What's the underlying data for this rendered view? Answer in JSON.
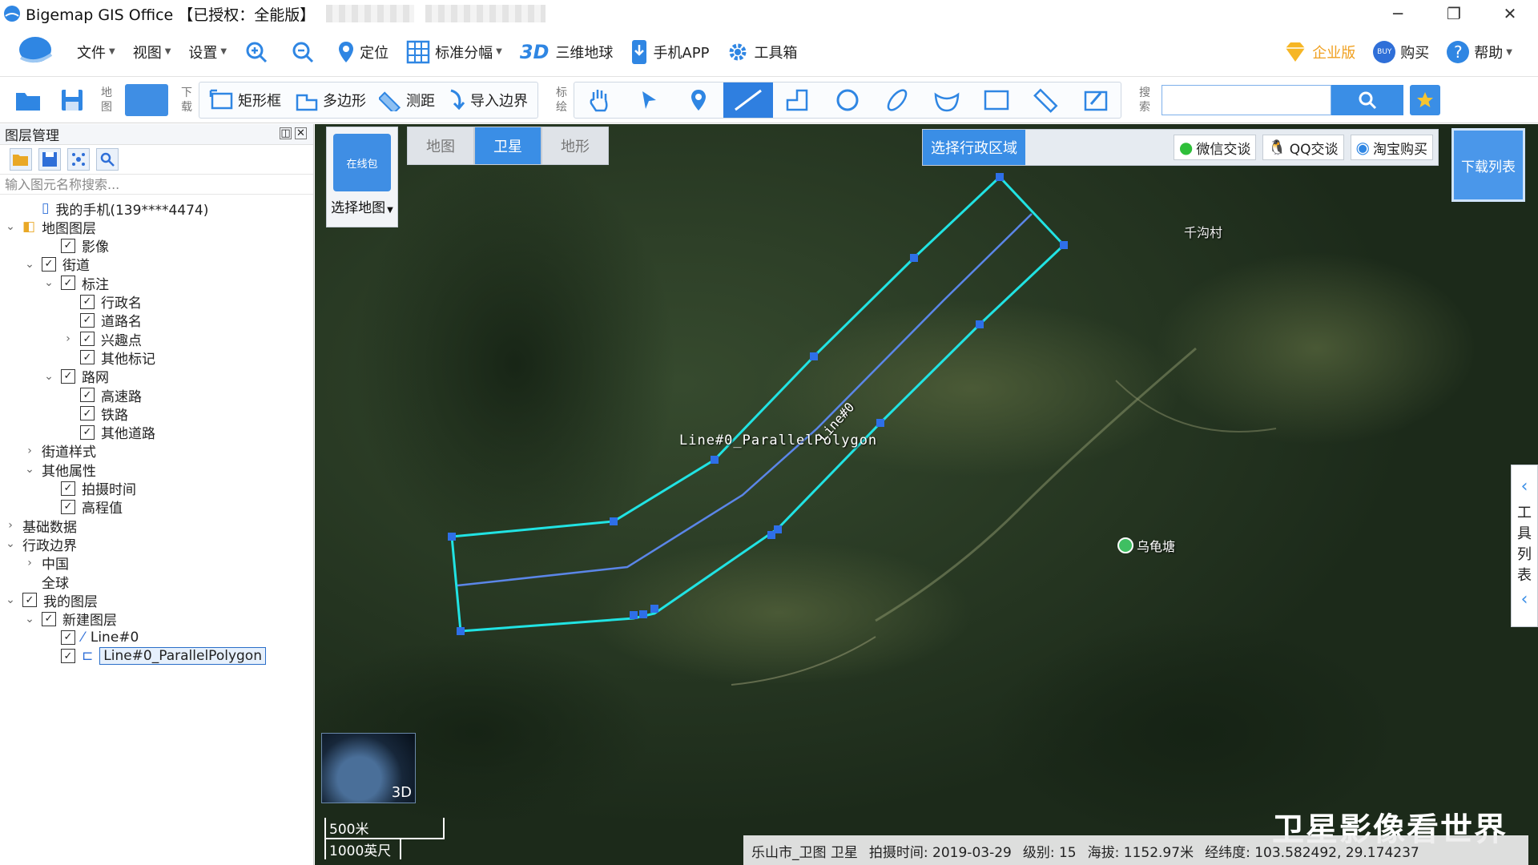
{
  "window": {
    "title": "Bigemap GIS Office 【已授权：全能版】",
    "minimize": "─",
    "restore": "❐",
    "close": "✕"
  },
  "menubar": {
    "items": [
      {
        "label": "文件"
      },
      {
        "label": "视图"
      },
      {
        "label": "设置"
      }
    ],
    "locate": "定位",
    "grid": "标准分幅",
    "three_d_mark": "3D",
    "earth": "三维地球",
    "mobile": "手机APP",
    "toolbox": "工具箱",
    "enterprise": "企业版",
    "buy": "购买",
    "buy_badge": "BUY",
    "help": "帮助"
  },
  "toolbar": {
    "map_label": "地图",
    "download_label": "下载",
    "rect": "矩形框",
    "polygon": "多边形",
    "measure": "测距",
    "import_boundary": "导入边界",
    "annotate_label": "标绘",
    "search_label": "搜索",
    "search_placeholder": ""
  },
  "layer_panel": {
    "title": "图层管理",
    "search_placeholder": "输入图元名称搜索...",
    "tree": [
      {
        "label": "我的手机(139****4474)",
        "level": 1,
        "arrow": "",
        "check": "none",
        "icon": "phone"
      },
      {
        "label": "地图图层",
        "level": 0,
        "arrow": "v",
        "check": "none",
        "icon": "layers"
      },
      {
        "label": "影像",
        "level": 2,
        "arrow": "",
        "check": "checked"
      },
      {
        "label": "街道",
        "level": 1,
        "arrow": "v",
        "check": "checked"
      },
      {
        "label": "标注",
        "level": 2,
        "arrow": "v",
        "check": "checked"
      },
      {
        "label": "行政名",
        "level": 3,
        "arrow": "",
        "check": "checked"
      },
      {
        "label": "道路名",
        "level": 3,
        "arrow": "",
        "check": "checked"
      },
      {
        "label": "兴趣点",
        "level": 3,
        "arrow": ">",
        "check": "checked"
      },
      {
        "label": "其他标记",
        "level": 3,
        "arrow": "",
        "check": "checked"
      },
      {
        "label": "路网",
        "level": 2,
        "arrow": "v",
        "check": "checked"
      },
      {
        "label": "高速路",
        "level": 3,
        "arrow": "",
        "check": "checked"
      },
      {
        "label": "铁路",
        "level": 3,
        "arrow": "",
        "check": "checked"
      },
      {
        "label": "其他道路",
        "level": 3,
        "arrow": "",
        "check": "checked"
      },
      {
        "label": "街道样式",
        "level": 1,
        "arrow": ">",
        "check": "none"
      },
      {
        "label": "其他属性",
        "level": 1,
        "arrow": "v",
        "check": "none"
      },
      {
        "label": "拍摄时间",
        "level": 2,
        "arrow": "",
        "check": "checked"
      },
      {
        "label": "高程值",
        "level": 2,
        "arrow": "",
        "check": "checked"
      },
      {
        "label": "基础数据",
        "level": 0,
        "arrow": ">",
        "check": "none"
      },
      {
        "label": "行政边界",
        "level": 0,
        "arrow": "v",
        "check": "none"
      },
      {
        "label": "中国",
        "level": 1,
        "arrow": ">",
        "check": "none"
      },
      {
        "label": "全球",
        "level": 1,
        "arrow": "",
        "check": "none"
      },
      {
        "label": "我的图层",
        "level": 0,
        "arrow": "v",
        "check": "checked"
      },
      {
        "label": "新建图层",
        "level": 1,
        "arrow": "v",
        "check": "checked"
      },
      {
        "label": "Line#0",
        "level": 2,
        "arrow": "",
        "check": "checked",
        "icon": "line"
      },
      {
        "label": "Line#0_ParallelPolygon",
        "level": 2,
        "arrow": "",
        "check": "checked",
        "icon": "polygon",
        "selected": true
      }
    ]
  },
  "map": {
    "type_tabs": [
      {
        "label": "地图",
        "active": false
      },
      {
        "label": "卫星",
        "active": true
      },
      {
        "label": "地形",
        "active": false
      }
    ],
    "select_map_label": "选择地图",
    "select_map_thumb": "在线包",
    "region_button": "选择行政区域",
    "wechat": "微信交谈",
    "qq": "QQ交谈",
    "taobao": "淘宝购买",
    "download_list": "下载列表",
    "side_tool": [
      "工",
      "具",
      "列",
      "表"
    ],
    "polygon_label": "Line#0_ParallelPolygon",
    "line_label": "Line#0",
    "place_1": "千沟村",
    "place_2": "乌龟塘",
    "globe_label": "3D",
    "scale_metric": "500米",
    "scale_imperial": "1000英尺",
    "watermark": "卫星影像看世界"
  },
  "status": {
    "source": "乐山市_卫图 卫星",
    "capture_label": "拍摄时间:",
    "capture_value": "2019-03-29",
    "level_label": "级别:",
    "level_value": "15",
    "alt_label": "海拔:",
    "alt_value": "1152.97米",
    "coord_label": "经纬度:",
    "coord_value": "103.582492, 29.174237"
  },
  "colors": {
    "accent": "#3a8ee6",
    "polygon": "#21e3e3",
    "line": "#5b86e8",
    "vertex": "#2e6fe8"
  }
}
